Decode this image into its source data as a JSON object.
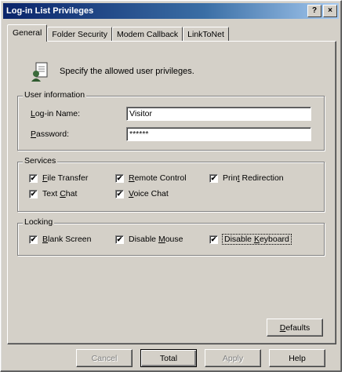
{
  "window": {
    "title": "Log-in List Privileges",
    "help_btn": "?",
    "close_btn": "×"
  },
  "tabs": [
    {
      "label": "General",
      "active": true
    },
    {
      "label": "Folder Security",
      "active": false
    },
    {
      "label": "Modem Callback",
      "active": false
    },
    {
      "label": "LinkToNet",
      "active": false
    }
  ],
  "general": {
    "intro_text": "Specify the allowed user privileges.",
    "user_info": {
      "legend": "User information",
      "login_label": "Log-in Name:",
      "login_value": "Visitor",
      "password_label": "Password:",
      "password_value": "******"
    },
    "services": {
      "legend": "Services",
      "items": [
        {
          "label": "File Transfer",
          "checked": true
        },
        {
          "label": "Remote Control",
          "checked": true
        },
        {
          "label": "Print Redirection",
          "checked": true
        },
        {
          "label": "Text Chat",
          "checked": true
        },
        {
          "label": "Voice Chat",
          "checked": true
        }
      ]
    },
    "locking": {
      "legend": "Locking",
      "items": [
        {
          "label": "Blank Screen",
          "checked": true
        },
        {
          "label": "Disable Mouse",
          "checked": true
        },
        {
          "label": "Disable Keyboard",
          "checked": true
        }
      ]
    },
    "defaults_button": "Defaults"
  },
  "footer": {
    "cancel": "Cancel",
    "ok": "Total",
    "apply": "Apply",
    "help": "Help"
  },
  "check_glyph": "✔"
}
